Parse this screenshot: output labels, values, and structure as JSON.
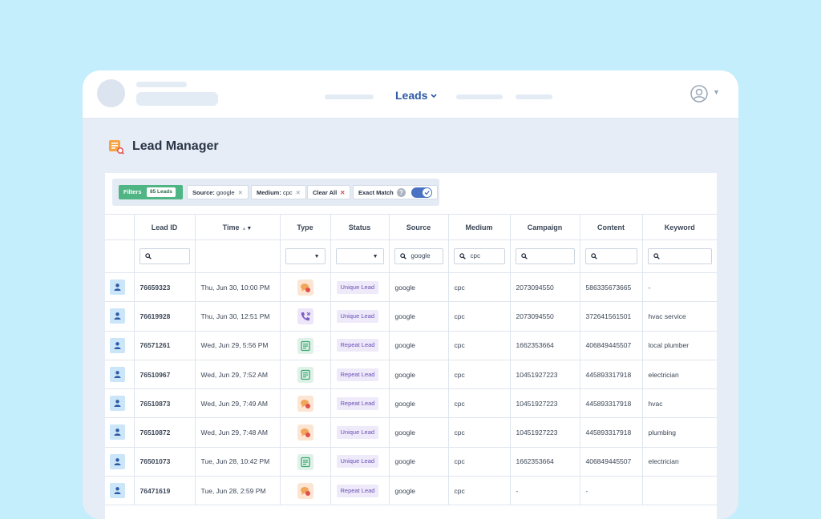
{
  "header": {
    "nav_label": "Leads"
  },
  "page": {
    "title": "Lead Manager"
  },
  "filters": {
    "label": "Filters",
    "count": "85 Leads",
    "chips": [
      {
        "key": "Source:",
        "value": "google"
      },
      {
        "key": "Medium:",
        "value": "cpc"
      }
    ],
    "clear_all": "Clear All",
    "exact_match": "Exact Match",
    "help": "?",
    "exact_match_on": true
  },
  "table": {
    "columns": [
      "Lead ID",
      "Time",
      "Type",
      "Status",
      "Source",
      "Medium",
      "Campaign",
      "Content",
      "Keyword"
    ],
    "search": {
      "source": "google",
      "medium": "cpc"
    },
    "rows": [
      {
        "id": "76659323",
        "time": "Thu, Jun 30, 10:00 PM",
        "type": "chat-icon",
        "status": "Unique Lead",
        "source": "google",
        "medium": "cpc",
        "campaign": "2073094550",
        "content": "586335673665",
        "keyword": "-"
      },
      {
        "id": "76619928",
        "time": "Thu, Jun 30, 12:51 PM",
        "type": "phone-icon",
        "status": "Unique Lead",
        "source": "google",
        "medium": "cpc",
        "campaign": "2073094550",
        "content": "372641561501",
        "keyword": "hvac service"
      },
      {
        "id": "76571261",
        "time": "Wed, Jun 29, 5:56 PM",
        "type": "form-icon",
        "status": "Repeat Lead",
        "source": "google",
        "medium": "cpc",
        "campaign": "1662353664",
        "content": "406849445507",
        "keyword": "local plumber"
      },
      {
        "id": "76510967",
        "time": "Wed, Jun 29, 7:52 AM",
        "type": "form-icon",
        "status": "Repeat Lead",
        "source": "google",
        "medium": "cpc",
        "campaign": "10451927223",
        "content": "445893317918",
        "keyword": "electrician"
      },
      {
        "id": "76510873",
        "time": "Wed, Jun 29, 7:49 AM",
        "type": "chat-icon",
        "status": "Repeat Lead",
        "source": "google",
        "medium": "cpc",
        "campaign": "10451927223",
        "content": "445893317918",
        "keyword": "hvac"
      },
      {
        "id": "76510872",
        "time": "Wed, Jun 29, 7:48 AM",
        "type": "chat-icon",
        "status": "Unique Lead",
        "source": "google",
        "medium": "cpc",
        "campaign": "10451927223",
        "content": "445893317918",
        "keyword": "plumbing"
      },
      {
        "id": "76501073",
        "time": "Tue, Jun 28, 10:42 PM",
        "type": "form-icon",
        "status": "Unique Lead",
        "source": "google",
        "medium": "cpc",
        "campaign": "1662353664",
        "content": "406849445507",
        "keyword": "electrician"
      },
      {
        "id": "76471619",
        "time": "Tue, Jun 28, 2:59 PM",
        "type": "chat-icon",
        "status": "Repeat Lead",
        "source": "google",
        "medium": "cpc",
        "campaign": "-",
        "content": "-",
        "keyword": ""
      }
    ]
  },
  "colors": {
    "background": "#c4eefb",
    "accent": "#2e5aa6",
    "filters_chip": "#4fb584",
    "status_badge": "#efeafa"
  }
}
